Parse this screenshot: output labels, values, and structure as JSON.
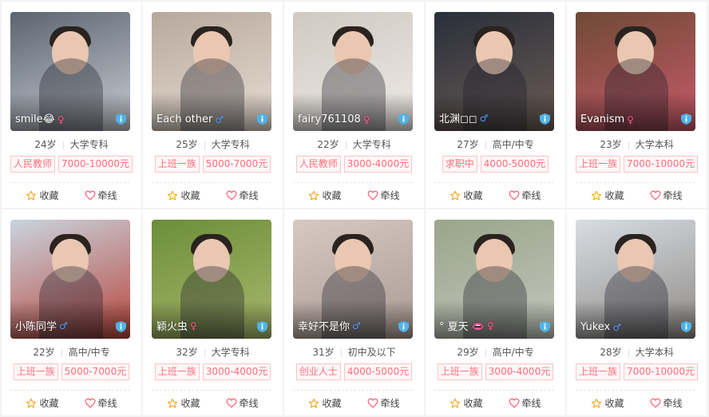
{
  "actions": {
    "favorite_label": "收藏",
    "connect_label": "牵线"
  },
  "colors": {
    "tag_text": "#ff6f7d",
    "tag_border": "#ffc2c7",
    "male": "#53a0ff",
    "female": "#ff5a8a",
    "verify_badge": "#4fb3e8"
  },
  "profiles": [
    {
      "nickname": "smile😂",
      "gender": "female",
      "age": "24岁",
      "education": "大学专科",
      "occupation": "人民教师",
      "income": "7000-10000元",
      "photo_bg": [
        "#5b6470",
        "#c9cdd3"
      ]
    },
    {
      "nickname": "Each other",
      "gender": "male",
      "age": "25岁",
      "education": "大学专科",
      "occupation": "上班一族",
      "income": "5000-7000元",
      "photo_bg": [
        "#b8a89c",
        "#e7ddd3"
      ]
    },
    {
      "nickname": "fairy761108",
      "gender": "female",
      "age": "22岁",
      "education": "大学专科",
      "occupation": "人民教师",
      "income": "3000-4000元",
      "photo_bg": [
        "#cfc9c1",
        "#eeeae6"
      ]
    },
    {
      "nickname": "北渊◻◻",
      "gender": "male",
      "age": "27岁",
      "education": "高中/中专",
      "occupation": "求职中",
      "income": "4000-5000元",
      "photo_bg": [
        "#2a2f3a",
        "#6b5d56"
      ]
    },
    {
      "nickname": "Evanism",
      "gender": "female",
      "age": "23岁",
      "education": "大学本科",
      "occupation": "上班一族",
      "income": "7000-10000元",
      "photo_bg": [
        "#6e4a36",
        "#c95a6a"
      ]
    },
    {
      "nickname": "小陈同学",
      "gender": "male",
      "age": "22岁",
      "education": "高中/中专",
      "occupation": "上班一族",
      "income": "5000-7000元",
      "photo_bg": [
        "#c9d4de",
        "#b8463d"
      ]
    },
    {
      "nickname": "颖火虫",
      "gender": "female",
      "age": "32岁",
      "education": "大学专科",
      "occupation": "上班一族",
      "income": "3000-4000元",
      "photo_bg": [
        "#6b8e3a",
        "#a9b86d"
      ]
    },
    {
      "nickname": "幸好不是你",
      "gender": "male",
      "age": "31岁",
      "education": "初中及以下",
      "occupation": "创业人士",
      "income": "4000-5000元",
      "photo_bg": [
        "#d8c8c0",
        "#a89a94"
      ]
    },
    {
      "nickname": "° 夏天 👄",
      "gender": "female",
      "age": "29岁",
      "education": "高中/中专",
      "occupation": "上班一族",
      "income": "3000-4000元",
      "photo_bg": [
        "#9aa58a",
        "#c2c6bd"
      ]
    },
    {
      "nickname": "Yukex",
      "gender": "male",
      "age": "28岁",
      "education": "大学本科",
      "occupation": "上班一族",
      "income": "7000-10000元",
      "photo_bg": [
        "#d8dde2",
        "#8e8a86"
      ]
    }
  ]
}
